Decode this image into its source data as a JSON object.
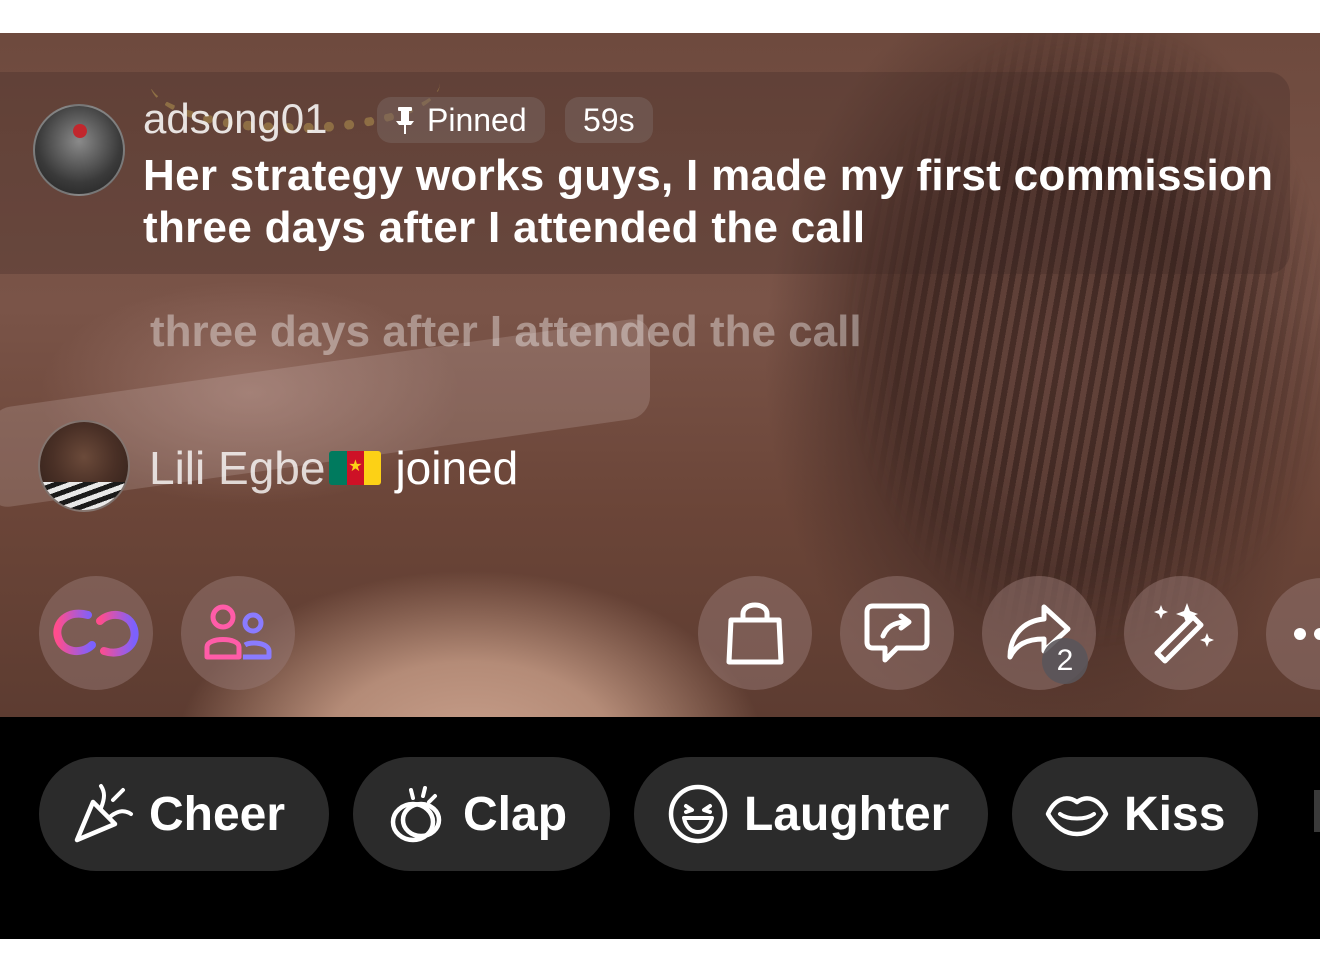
{
  "comment": {
    "username": "adsong01",
    "pinned_label": "Pinned",
    "time_ago": "59s",
    "message": "Her strategy works guys, I made my first commission three days after I attended the call"
  },
  "faded_comment_line": "three days after I attended the call",
  "join_event": {
    "name": "Lili Egbe",
    "flag_icon": "cameroon-flag-icon",
    "action": "joined"
  },
  "action_buttons": {
    "share_count": "2",
    "icons": [
      "link-icon",
      "people-icon",
      "shopping-bag-icon",
      "chat-share-icon",
      "share-arrow-icon",
      "magic-wand-icon",
      "more-icon"
    ]
  },
  "reactions": [
    {
      "label": "Cheer",
      "icon": "party-popper-icon"
    },
    {
      "label": "Clap",
      "icon": "clap-icon"
    },
    {
      "label": "Laughter",
      "icon": "laughing-face-icon"
    },
    {
      "label": "Kiss",
      "icon": "lips-icon"
    }
  ],
  "colors": {
    "reaction_bg": "#2b2b2b",
    "bottom_bar": "#000000",
    "link_icon_gradient": [
      "#ff4d8d",
      "#7b61ff"
    ]
  }
}
